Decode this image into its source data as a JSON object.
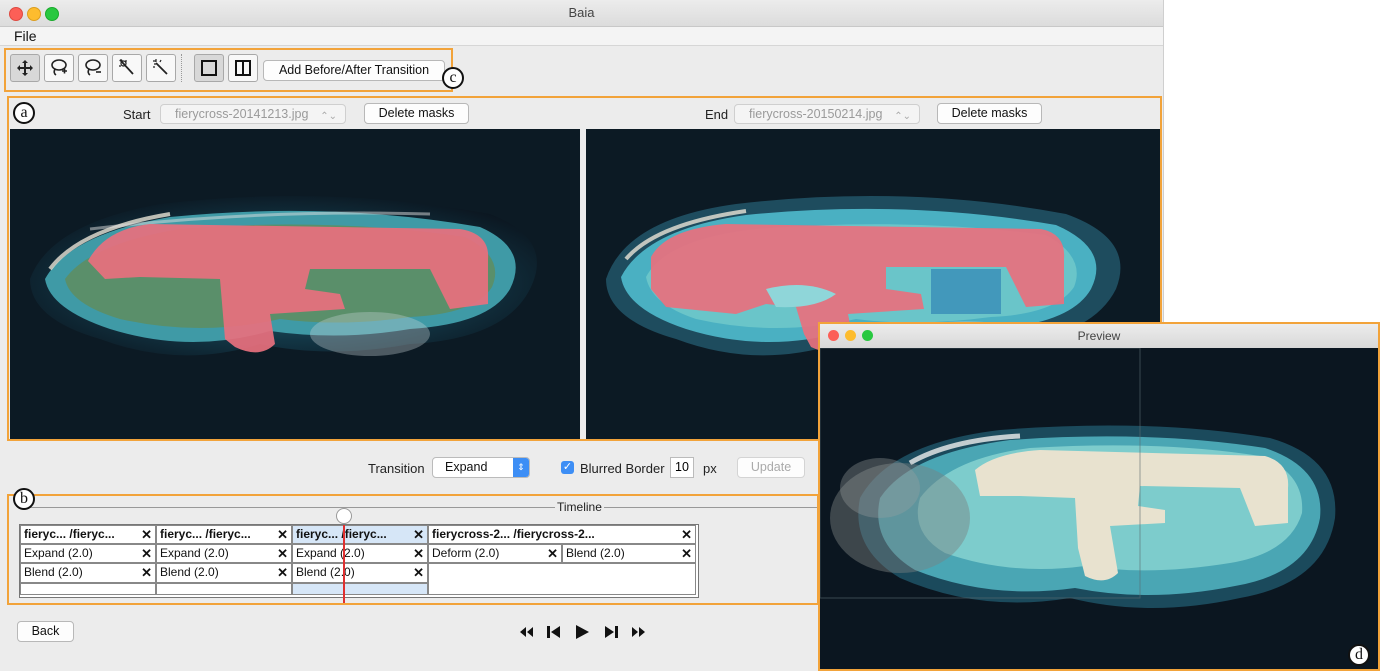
{
  "window": {
    "title": "Baia"
  },
  "menu": {
    "file": "File"
  },
  "toolbar": {
    "tools": [
      "move-icon",
      "lasso-add-icon",
      "lasso-remove-icon",
      "magic-wand-icon",
      "magic-wand-alt-icon"
    ],
    "view_modes": [
      "single-view-icon",
      "split-view-icon"
    ],
    "add_transition_label": "Add Before/After Transition"
  },
  "callouts": {
    "a": "a",
    "b": "b",
    "c": "c",
    "d": "d"
  },
  "editor": {
    "start_label": "Start",
    "start_file": "fierycross-20141213.jpg",
    "end_label": "End",
    "end_file": "fierycross-20150214.jpg",
    "delete_masks_label": "Delete masks"
  },
  "controls": {
    "transition_label": "Transition",
    "transition_value": "Expand",
    "blurred_border_label": "Blurred Border",
    "blurred_border_checked": true,
    "border_px": "10",
    "px_unit": "px",
    "update_label": "Update"
  },
  "timeline": {
    "title": "Timeline",
    "columns": [
      {
        "header": "fieryc... /fieryc...",
        "rows": [
          "Expand (2.0)",
          "Blend (2.0)"
        ]
      },
      {
        "header": "fieryc... /fieryc...",
        "rows": [
          "Expand (2.0)",
          "Blend (2.0)"
        ]
      },
      {
        "header": "fieryc... /fieryc...",
        "rows": [
          "Expand (2.0)",
          "Blend (2.0)"
        ]
      },
      {
        "header": "fierycross-2... /fierycross-2...",
        "rows": [
          "Deform (2.0)",
          "Blend (2.0)"
        ]
      }
    ],
    "close_glyph": "✕"
  },
  "playback": {
    "back_label": "Back",
    "buttons": [
      "rewind-icon",
      "skip-back-icon",
      "play-icon",
      "skip-forward-icon",
      "fast-forward-icon"
    ]
  },
  "preview": {
    "title": "Preview"
  },
  "colors": {
    "highlight": "#f2a33a",
    "mask": "#e8707e",
    "playhead": "#e03030",
    "selected": "#d6e6f7"
  }
}
